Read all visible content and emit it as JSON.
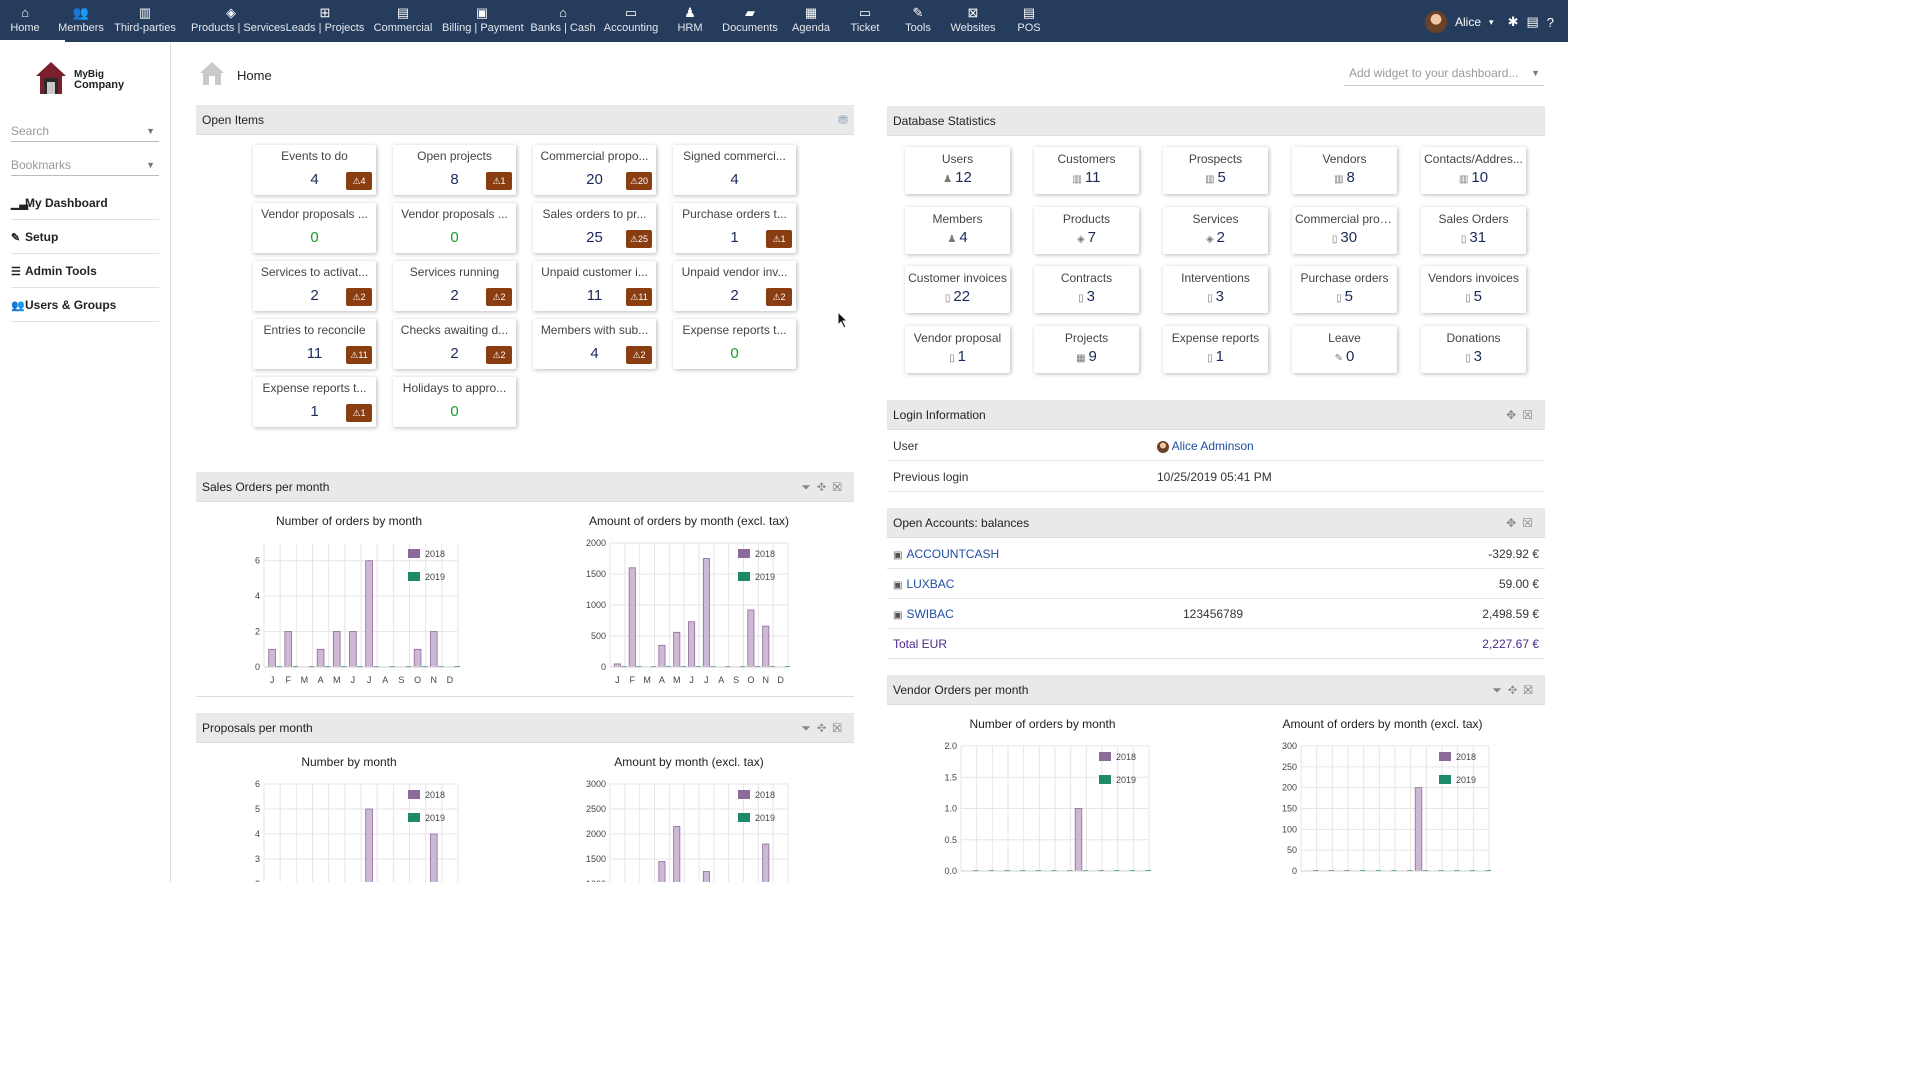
{
  "topmenu": [
    {
      "label": "Home",
      "icon": "home-icon",
      "glyph": "⌂",
      "active": true
    },
    {
      "label": "Members",
      "icon": "members-icon",
      "glyph": "👥"
    },
    {
      "label": "Third-parties",
      "icon": "building-icon",
      "glyph": "▥"
    },
    {
      "label": "Products | Services",
      "icon": "cube-icon",
      "glyph": "◈"
    },
    {
      "label": "Leads | Projects",
      "icon": "sitemap-icon",
      "glyph": "⊞"
    },
    {
      "label": "Commercial",
      "icon": "suitcase-icon",
      "glyph": "▤"
    },
    {
      "label": "Billing | Payment",
      "icon": "money-icon",
      "glyph": "▣"
    },
    {
      "label": "Banks | Cash",
      "icon": "bank-icon",
      "glyph": "⌂"
    },
    {
      "label": "Accounting",
      "icon": "credit-card-icon",
      "glyph": "▭"
    },
    {
      "label": "HRM",
      "icon": "user-tie-icon",
      "glyph": "♟"
    },
    {
      "label": "Documents",
      "icon": "folder-open-icon",
      "glyph": "▰"
    },
    {
      "label": "Agenda",
      "icon": "calendar-icon",
      "glyph": "▦"
    },
    {
      "label": "Ticket",
      "icon": "ticket-icon",
      "glyph": "▭"
    },
    {
      "label": "Tools",
      "icon": "wrench-icon",
      "glyph": "✎"
    },
    {
      "label": "Websites",
      "icon": "network-icon",
      "glyph": "⊠"
    },
    {
      "label": "POS",
      "icon": "cash-register-icon",
      "glyph": "▤"
    }
  ],
  "user": {
    "name": "Alice"
  },
  "sidebar": {
    "company_line1": "MyBig",
    "company_line2": "Company",
    "search_placeholder": "Search",
    "bookmarks_placeholder": "Bookmarks",
    "menu": [
      {
        "label": "My Dashboard",
        "icon": "chart-icon",
        "glyph": "▁▃"
      },
      {
        "label": "Setup",
        "icon": "wrench-icon",
        "glyph": "✎"
      },
      {
        "label": "Admin Tools",
        "icon": "bars-icon",
        "glyph": "☰"
      },
      {
        "label": "Users & Groups",
        "icon": "users-icon",
        "glyph": "👥"
      }
    ]
  },
  "page": {
    "title": "Home",
    "add_widget_placeholder": "Add widget to your dashboard..."
  },
  "open_items": {
    "title": "Open Items",
    "boxes": [
      {
        "label": "Events to do",
        "value": "4",
        "warn": "4"
      },
      {
        "label": "Open projects",
        "value": "8",
        "warn": "1"
      },
      {
        "label": "Commercial propo...",
        "value": "20",
        "warn": "20"
      },
      {
        "label": "Signed commerci...",
        "value": "4",
        "warn": ""
      },
      {
        "label": "Vendor proposals ...",
        "value": "0",
        "warn": ""
      },
      {
        "label": "Vendor proposals ...",
        "value": "0",
        "warn": ""
      },
      {
        "label": "Sales orders to pr...",
        "value": "25",
        "warn": "25"
      },
      {
        "label": "Purchase orders t...",
        "value": "1",
        "warn": "1"
      },
      {
        "label": "Services to activat...",
        "value": "2",
        "warn": "2"
      },
      {
        "label": "Services running",
        "value": "2",
        "warn": "2"
      },
      {
        "label": "Unpaid customer i...",
        "value": "11",
        "warn": "11"
      },
      {
        "label": "Unpaid vendor inv...",
        "value": "2",
        "warn": "2"
      },
      {
        "label": "Entries to reconcile",
        "value": "11",
        "warn": "11"
      },
      {
        "label": "Checks awaiting d...",
        "value": "2",
        "warn": "2"
      },
      {
        "label": "Members with sub...",
        "value": "4",
        "warn": "2"
      },
      {
        "label": "Expense reports t...",
        "value": "0",
        "warn": ""
      },
      {
        "label": "Expense reports t...",
        "value": "1",
        "warn": "1"
      },
      {
        "label": "Holidays to appro...",
        "value": "0",
        "warn": ""
      }
    ]
  },
  "db_stats": {
    "title": "Database Statistics",
    "boxes": [
      {
        "label": "Users",
        "value": "12"
      },
      {
        "label": "Customers",
        "value": "11"
      },
      {
        "label": "Prospects",
        "value": "5"
      },
      {
        "label": "Vendors",
        "value": "8"
      },
      {
        "label": "Contacts/Addres...",
        "value": "10"
      },
      {
        "label": "Members",
        "value": "4"
      },
      {
        "label": "Products",
        "value": "7"
      },
      {
        "label": "Services",
        "value": "2"
      },
      {
        "label": "Commercial prop...",
        "value": "30"
      },
      {
        "label": "Sales Orders",
        "value": "31"
      },
      {
        "label": "Customer invoices",
        "value": "22"
      },
      {
        "label": "Contracts",
        "value": "3"
      },
      {
        "label": "Interventions",
        "value": "3"
      },
      {
        "label": "Purchase orders",
        "value": "5"
      },
      {
        "label": "Vendors invoices",
        "value": "5"
      },
      {
        "label": "Vendor proposal",
        "value": "1"
      },
      {
        "label": "Projects",
        "value": "9"
      },
      {
        "label": "Expense reports",
        "value": "1"
      },
      {
        "label": "Leave",
        "value": "0"
      },
      {
        "label": "Donations",
        "value": "3"
      }
    ]
  },
  "login_info": {
    "title": "Login Information",
    "user_label": "User",
    "user_value": "Alice Adminson",
    "prev_label": "Previous login",
    "prev_value": "10/25/2019 05:41 PM"
  },
  "accounts": {
    "title": "Open Accounts: balances",
    "rows": [
      {
        "name": "ACCOUNTCASH",
        "number": "",
        "balance": "-329.92 €"
      },
      {
        "name": "LUXBAC",
        "number": "",
        "balance": "59.00 €"
      },
      {
        "name": "SWIBAC",
        "number": "123456789",
        "balance": "2,498.59 €"
      }
    ],
    "total_label": "Total EUR",
    "total_value": "2,227.67 €"
  },
  "panels": {
    "sales_orders": "Sales Orders per month",
    "proposals": "Proposals per month",
    "vendor_orders": "Vendor Orders per month"
  },
  "colors": {
    "s2018": "#cdb8d6",
    "s2018_stroke": "#8c6b9a",
    "s2019": "#1f8a6a",
    "topbar": "#263c5c"
  },
  "chart_data": [
    {
      "id": "so-count",
      "type": "bar",
      "title": "Number of orders by month",
      "categories": [
        "J",
        "F",
        "M",
        "A",
        "M",
        "J",
        "J",
        "A",
        "S",
        "O",
        "N",
        "D"
      ],
      "series": [
        {
          "name": "2018",
          "values": [
            1,
            2,
            0,
            1,
            2,
            2,
            6,
            0,
            0,
            1,
            2,
            0
          ]
        },
        {
          "name": "2019",
          "values": [
            0,
            0,
            0,
            0,
            0,
            0,
            0,
            0,
            0,
            0,
            0,
            0
          ]
        }
      ],
      "ylim": [
        0,
        7
      ],
      "yticks": [
        0,
        2,
        4,
        6
      ]
    },
    {
      "id": "so-amount",
      "type": "bar",
      "title": "Amount of orders by month (excl. tax)",
      "categories": [
        "J",
        "F",
        "M",
        "A",
        "M",
        "J",
        "J",
        "A",
        "S",
        "O",
        "N",
        "D"
      ],
      "series": [
        {
          "name": "2018",
          "values": [
            50,
            1600,
            0,
            350,
            560,
            730,
            1750,
            0,
            0,
            920,
            660,
            0
          ]
        },
        {
          "name": "2019",
          "values": [
            0,
            0,
            0,
            0,
            0,
            0,
            0,
            0,
            0,
            0,
            0,
            0
          ]
        }
      ],
      "ylim": [
        0,
        2000
      ],
      "yticks": [
        0,
        500,
        1000,
        1500,
        2000
      ]
    },
    {
      "id": "prop-count",
      "type": "bar",
      "title": "Number by month",
      "categories": [
        "J",
        "F",
        "M",
        "A",
        "M",
        "J",
        "J",
        "A",
        "S",
        "O",
        "N",
        "D"
      ],
      "series": [
        {
          "name": "2018",
          "values": [
            0,
            2,
            0,
            2,
            2,
            2,
            5,
            0,
            0,
            0,
            4,
            0
          ]
        },
        {
          "name": "2019",
          "values": [
            0,
            0,
            0,
            0,
            0,
            0,
            0,
            0,
            0,
            0,
            0,
            0
          ]
        }
      ],
      "ylim": [
        0,
        6
      ],
      "yticks": [
        2,
        3,
        4,
        5,
        6
      ]
    },
    {
      "id": "prop-amount",
      "type": "bar",
      "title": "Amount by month (excl. tax)",
      "categories": [
        "J",
        "F",
        "M",
        "A",
        "M",
        "J",
        "J",
        "A",
        "S",
        "O",
        "N",
        "D"
      ],
      "series": [
        {
          "name": "2018",
          "values": [
            0,
            0,
            0,
            1450,
            2150,
            1000,
            1250,
            0,
            0,
            0,
            1800,
            0
          ]
        },
        {
          "name": "2019",
          "values": [
            0,
            0,
            0,
            0,
            0,
            0,
            0,
            0,
            0,
            0,
            0,
            0
          ]
        }
      ],
      "ylim": [
        0,
        3000
      ],
      "yticks": [
        1000,
        1500,
        2000,
        2500,
        3000
      ]
    },
    {
      "id": "vo-count",
      "type": "bar",
      "title": "Number of orders by month",
      "categories": [
        "J",
        "F",
        "M",
        "A",
        "M",
        "J",
        "J",
        "A",
        "S",
        "O",
        "N",
        "D"
      ],
      "series": [
        {
          "name": "2018",
          "values": [
            0,
            0,
            0,
            0,
            0,
            0,
            0,
            1,
            0,
            0,
            0,
            0
          ]
        },
        {
          "name": "2019",
          "values": [
            0,
            0,
            0,
            0,
            0,
            0,
            0,
            0,
            0,
            0,
            0,
            0
          ]
        }
      ],
      "ylim": [
        0,
        2.0
      ],
      "yticks": [
        0.0,
        0.5,
        1.0,
        1.5,
        2.0
      ],
      "ytick_labels": [
        "0.0",
        "0.5",
        "1.0",
        "1.5",
        "2.0"
      ]
    },
    {
      "id": "vo-amount",
      "type": "bar",
      "title": "Amount of orders by month (excl. tax)",
      "categories": [
        "J",
        "F",
        "M",
        "A",
        "M",
        "J",
        "J",
        "A",
        "S",
        "O",
        "N",
        "D"
      ],
      "series": [
        {
          "name": "2018",
          "values": [
            0,
            0,
            0,
            0,
            0,
            0,
            0,
            200,
            0,
            0,
            0,
            0
          ]
        },
        {
          "name": "2019",
          "values": [
            0,
            0,
            0,
            0,
            0,
            0,
            0,
            0,
            0,
            0,
            0,
            0
          ]
        }
      ],
      "ylim": [
        0,
        300
      ],
      "yticks": [
        0,
        50,
        100,
        150,
        200,
        250,
        300
      ]
    }
  ]
}
